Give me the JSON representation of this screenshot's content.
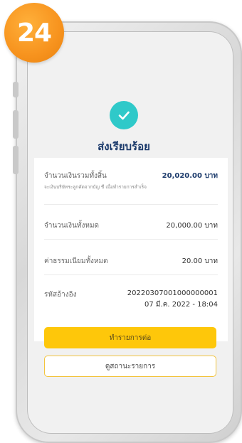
{
  "step_badge": "24",
  "success": {
    "title": "ส่งเรียบร้อย"
  },
  "summary": {
    "total_label": "จำนวนเงินรวมทั้งสิ้น",
    "total_value": "20,020.00 บาท",
    "total_note": "จะเงินบริษัทระลูกคัดจากบัญ ชี เมื่อทำรายการสำเร็จ",
    "amount_label": "จำนวนเงินทั้งหมด",
    "amount_value": "20,000.00 บาท",
    "fee_label": "ค่าธรรมเนียมทั้งหมด",
    "fee_value": "20.00 บาท",
    "ref_label": "รหัสอ้างอิง",
    "ref_value": "20220307001000000001",
    "ref_datetime": "07 มี.ค. 2022 - 18:04"
  },
  "buttons": {
    "continue": "ทำรายการต่อ",
    "view_status": "ดูสถานะรายการ"
  },
  "colors": {
    "badge": "#f7931e",
    "success": "#2fc9c9",
    "title": "#1b3a6b",
    "primary_button": "#fec70a",
    "secondary_border": "#f3c43d"
  }
}
